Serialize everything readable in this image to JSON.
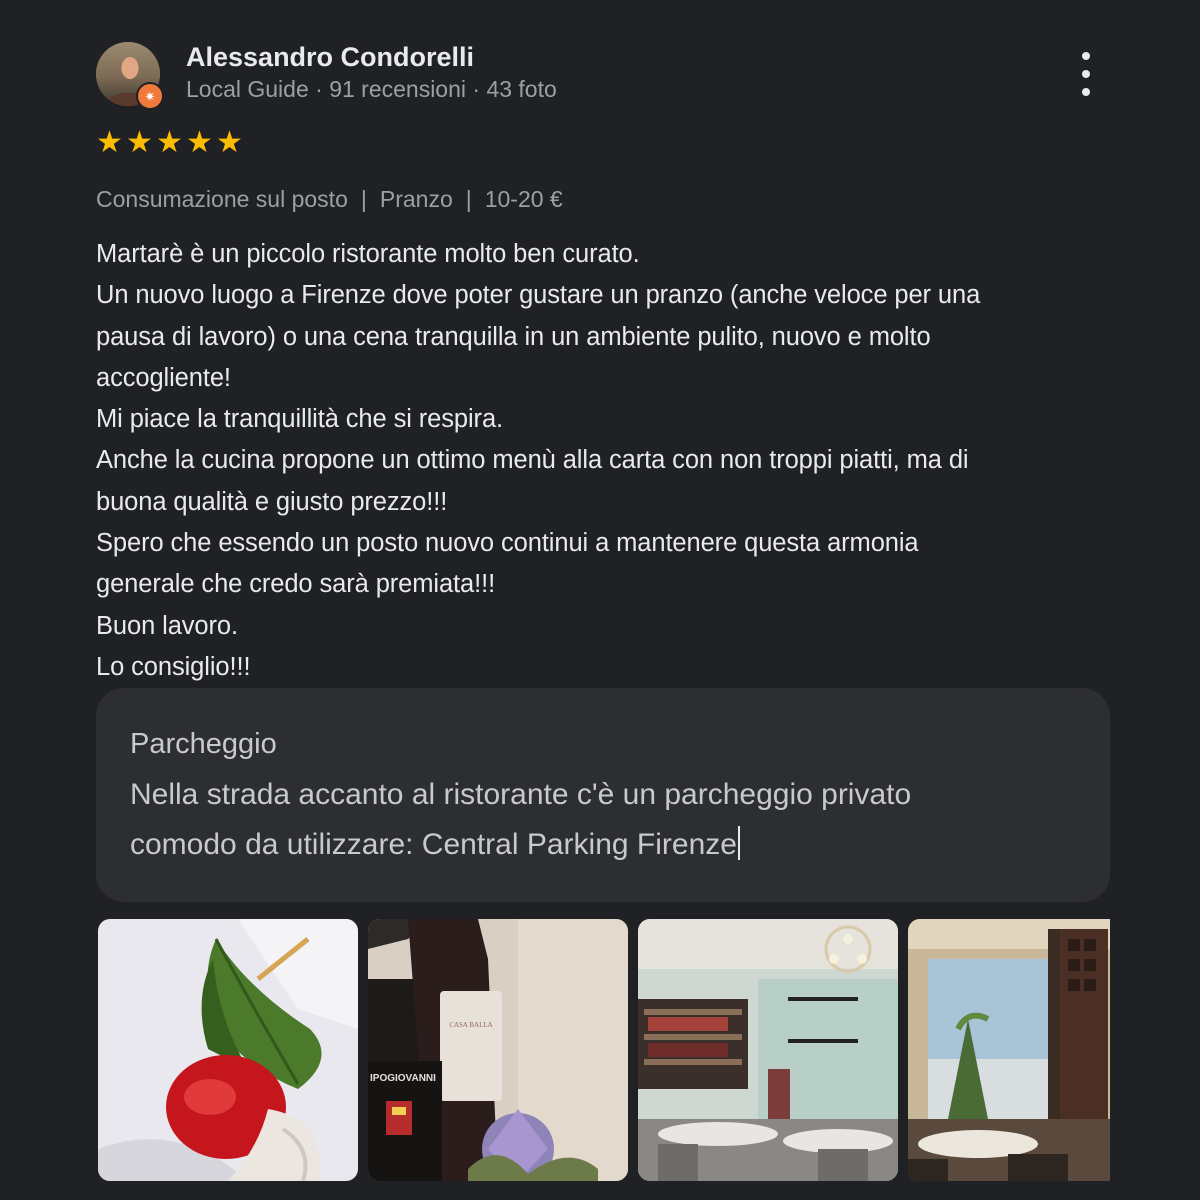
{
  "reviewer": {
    "name": "Alessandro Condorelli",
    "meta": "Local Guide · 91 recensioni · 43 foto",
    "avatar_icon": "person-photo",
    "badge_icon": "local-guide-star-icon"
  },
  "rating": {
    "stars": 5,
    "max": 5,
    "star_color": "#fbbc04"
  },
  "tags": [
    "Consumazione sul posto",
    "Pranzo",
    "10-20 €"
  ],
  "tag_separator": "|",
  "review": {
    "lines": [
      "Martarè è un piccolo ristorante molto ben curato.",
      "Un nuovo luogo a Firenze dove poter gustare un pranzo (anche veloce per una",
      "pausa di lavoro) o una cena tranquilla in un ambiente pulito, nuovo e molto",
      "accogliente!",
      "Mi piace la tranquillità che si respira.",
      "Anche la cucina propone un ottimo menù alla carta con non troppi piatti, ma di",
      "buona qualità e giusto prezzo!!!",
      "Spero che essendo un posto nuovo continui a mantenere questa armonia",
      "generale che credo sarà premiata!!!",
      "Buon lavoro.",
      "Lo consiglio!!!"
    ]
  },
  "parking": {
    "title": "Parcheggio",
    "lines": [
      "Nella strada accanto al ristorante c'è un parcheggio privato",
      "comodo da utilizzare: Central Parking Firenze"
    ]
  },
  "photos": [
    {
      "subject": "caprese-skewer-photo"
    },
    {
      "subject": "wine-bottles-photo",
      "label": "IPOGIOVANNI"
    },
    {
      "subject": "restaurant-interior-photo"
    },
    {
      "subject": "dining-room-window-photo"
    }
  ],
  "colors": {
    "background": "#202124",
    "panel": "#2d2e31",
    "text_primary": "#e8eaed",
    "text_secondary": "#9aa0a6"
  }
}
